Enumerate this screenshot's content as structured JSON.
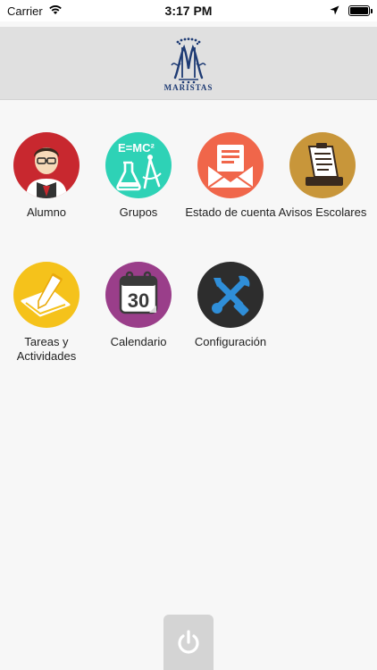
{
  "status_bar": {
    "carrier": "Carrier",
    "time": "3:17 PM"
  },
  "header": {
    "logo_text": "MARISTAS"
  },
  "menu": [
    {
      "label": "Alumno",
      "icon": "student-icon",
      "color": "#c8282f"
    },
    {
      "label": "Grupos",
      "icon": "science-icon",
      "color": "#2ed2b6"
    },
    {
      "label": "Estado de cuenta",
      "icon": "envelope-icon",
      "color": "#f0664a"
    },
    {
      "label": "Avisos Escolares",
      "icon": "notice-icon",
      "color": "#c8963a"
    },
    {
      "label": "Tareas y\nActividades",
      "icon": "homework-icon",
      "color": "#f5c21b"
    },
    {
      "label": "Calendario",
      "icon": "calendar-icon",
      "color": "#9a3e8a"
    },
    {
      "label": "Configuración",
      "icon": "tools-icon",
      "color": "#2d2d2d"
    }
  ],
  "footer": {
    "power_icon": "power-icon"
  }
}
